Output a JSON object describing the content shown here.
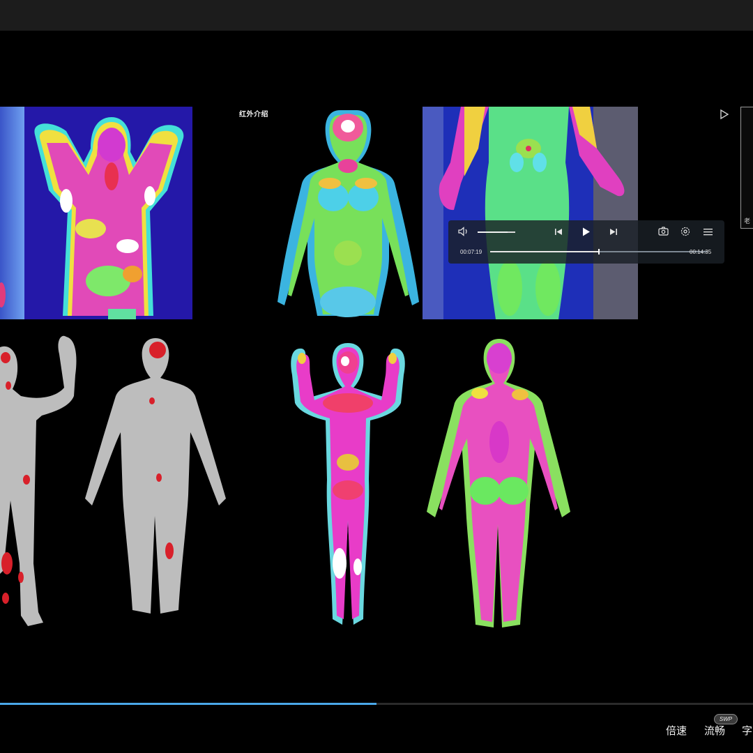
{
  "slide": {
    "label": "红外介绍"
  },
  "player": {
    "current_time": "00:07:19",
    "total_time": "00:14:35",
    "progress": 0.5,
    "volume": 0.8
  },
  "video": {
    "progress": 0.5
  },
  "bottom_bar": {
    "speed_label": "倍速",
    "quality_label": "流畅",
    "subtitle_label": "字",
    "badge": "SWP"
  },
  "side_panel": {
    "label": "老"
  },
  "colors": {
    "accent": "#4aa8e8"
  }
}
